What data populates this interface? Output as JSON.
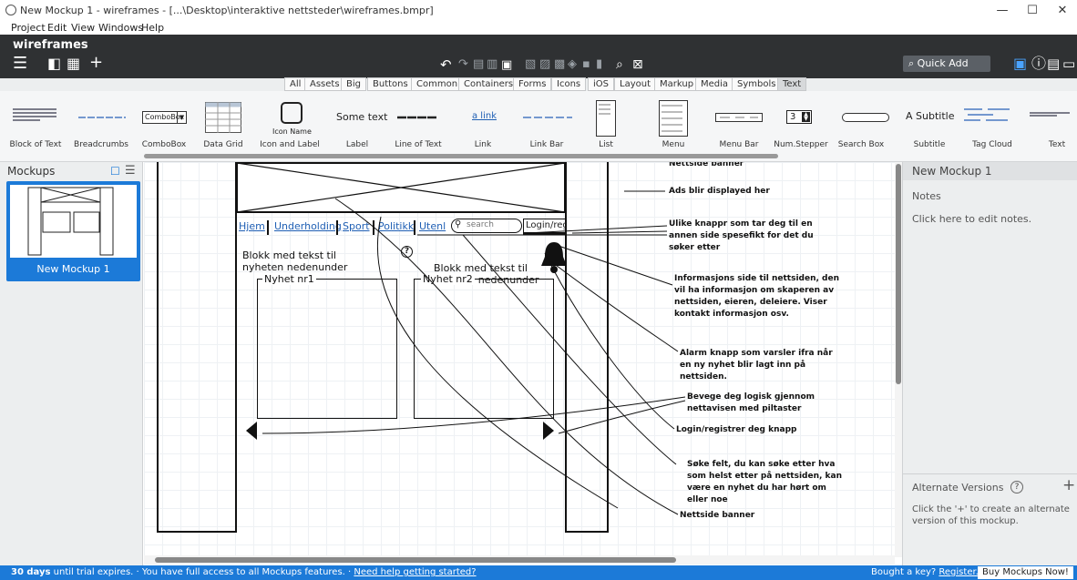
{
  "window": {
    "title": "New Mockup 1 - wireframes - [...\\Desktop\\interaktive nettsteder\\wireframes.bmpr]",
    "minimize": "—",
    "maximize": "☐",
    "close": "✕"
  },
  "menu": [
    "Project",
    "Edit",
    "View",
    "Windows",
    "Help"
  ],
  "toolbar": {
    "app_name": "wireframes",
    "quick_add": "Quick Add"
  },
  "filters": [
    "All",
    "Assets",
    "Big",
    "Buttons",
    "Common",
    "Containers",
    "Forms",
    "Icons",
    "iOS",
    "Layout",
    "Markup",
    "Media",
    "Symbols",
    "Text"
  ],
  "filter_active": "Text",
  "components": [
    {
      "label": "Block of Text"
    },
    {
      "label": "Breadcrumbs"
    },
    {
      "label": "ComboBox",
      "preview": "ComboBox"
    },
    {
      "label": "Data Grid"
    },
    {
      "label": "Icon and Label",
      "preview": "Icon Name"
    },
    {
      "label": "Label",
      "preview": "Some text"
    },
    {
      "label": "Line of Text"
    },
    {
      "label": "Link",
      "preview": "a link"
    },
    {
      "label": "Link Bar"
    },
    {
      "label": "List"
    },
    {
      "label": "Menu"
    },
    {
      "label": "Menu Bar"
    },
    {
      "label": "Num.Stepper",
      "preview": "3"
    },
    {
      "label": "Search Box"
    },
    {
      "label": "Subtitle",
      "preview": "A Subtitle"
    },
    {
      "label": "Tag Cloud"
    },
    {
      "label": "Text"
    }
  ],
  "left_panel": {
    "title": "Mockups",
    "mockup_name": "New Mockup 1"
  },
  "mockup": {
    "nav": [
      "Hjem",
      "Underholding",
      "Sport",
      "Politikk",
      "Utenl"
    ],
    "search_placeholder": "search",
    "login": "Login/reg",
    "help_glyph": "?",
    "block1": "Blokk med tekst til nyheten nedenunder",
    "block2": "Blokk med tekst til nyheten nedenunder",
    "news1": "Nyhet nr1",
    "news2": "Nyhet nr2"
  },
  "annotations": {
    "banner_top": "Nettside banner",
    "ads": "Ads blir displayed her",
    "buttons": "Ulike knappr som tar deg til en annen side spesefikt for det du søker etter",
    "info": "Informasjons side til nettsiden, den vil ha informasjon om skaperen av nettsiden, eieren, deleiere. Viser kontakt informasjon osv.",
    "alarm": "Alarm knapp som varsler ifra når en ny nyhet blir lagt inn på nettsiden.",
    "arrows": "Bevege deg logisk gjennom nettavisen med piltaster",
    "login": "Login/registrer deg knapp",
    "search": "Søke felt, du kan søke etter hva som helst etter på nettsiden, kan være en nyhet du har hørt om eller noe",
    "banner_bottom": "Nettside banner"
  },
  "right_panel": {
    "mockup_title": "New Mockup 1",
    "notes_label": "Notes",
    "notes_hint": "Click here to edit notes.",
    "alternate_title": "Alternate Versions",
    "alternate_help": "?",
    "alternate_add": "+",
    "alternate_desc": "Click the '+' to create an alternate version of this mockup."
  },
  "status": {
    "days": "30 days",
    "trial": " until trial expires.  ·  You have full access to all Mockups features.  ·  ",
    "help_link": "Need help getting started?",
    "bought": "Bought a key? ",
    "register": "Register...",
    "buy": "Buy Mockups Now!"
  }
}
